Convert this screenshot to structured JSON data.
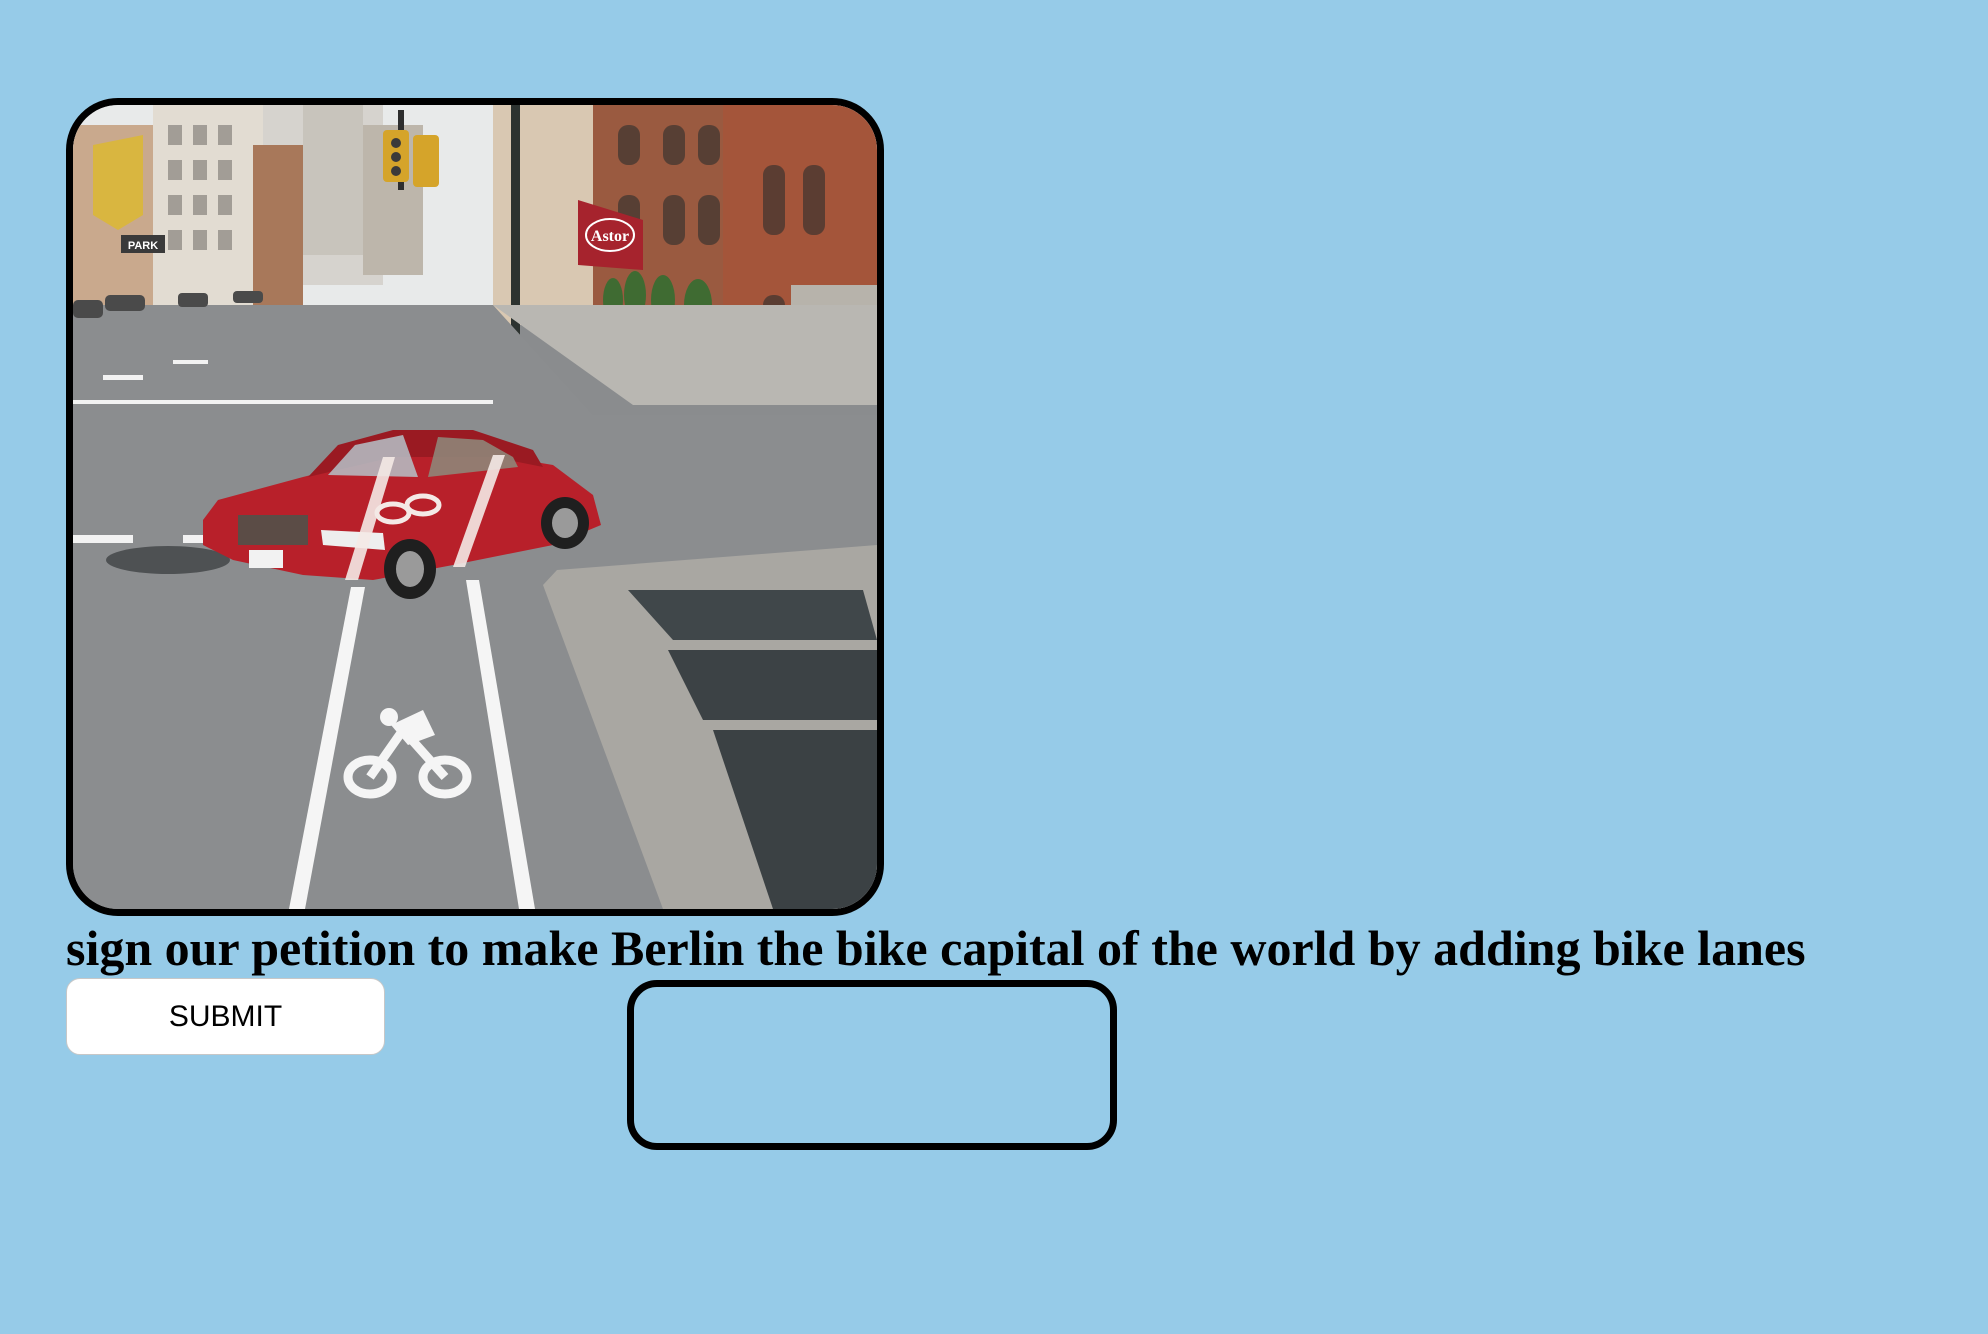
{
  "petition": {
    "headline": "sign our petition to make Berlin the bike capital of the world by adding bike lanes",
    "submit_label": "SUBMIT",
    "input_value": ""
  },
  "image": {
    "alt": "Red car on a city street with a bike lane painted over it",
    "sign_text": "Astor",
    "store_sign_text": "PARK"
  },
  "colors": {
    "background": "#96cbe8",
    "border": "#000000",
    "button": "#ffffff",
    "car": "#b8202a"
  }
}
